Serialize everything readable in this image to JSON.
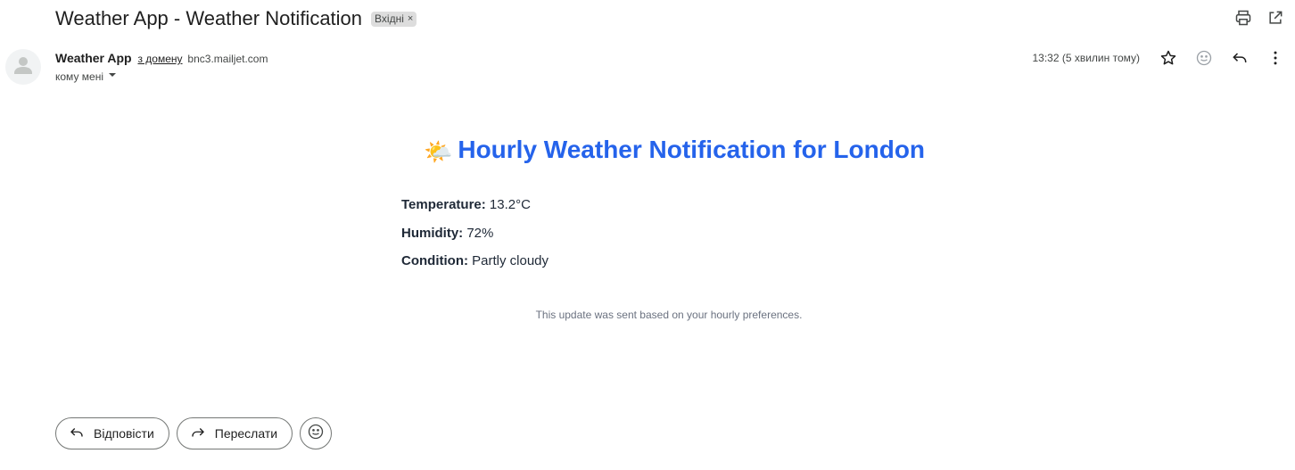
{
  "email": {
    "subject": "Weather App - Weather Notification",
    "label": "Вхідні",
    "label_remove": "×",
    "sender_name": "Weather App",
    "via_text": "з домену",
    "via_domain": "bnc3.mailjet.com",
    "recipient": "кому мені",
    "time": "13:32 (5 хвилин тому)"
  },
  "content": {
    "emoji": "🌤️",
    "title": "Hourly Weather Notification for London",
    "fields": [
      {
        "label": "Temperature:",
        "value": "13.2°C"
      },
      {
        "label": "Humidity:",
        "value": "72%"
      },
      {
        "label": "Condition:",
        "value": "Partly cloudy"
      }
    ],
    "footer": "This update was sent based on your hourly preferences."
  },
  "actions": {
    "reply": "Відповісти",
    "forward": "Переслати"
  },
  "colors": {
    "title": "#2563eb",
    "label_chip": "#dddddd"
  },
  "icons": [
    "print-icon",
    "open-new-window-icon",
    "star-icon",
    "emoji-icon",
    "reply-icon",
    "more-vert-icon",
    "forward-icon",
    "person-icon",
    "dropdown-arrow-icon"
  ]
}
